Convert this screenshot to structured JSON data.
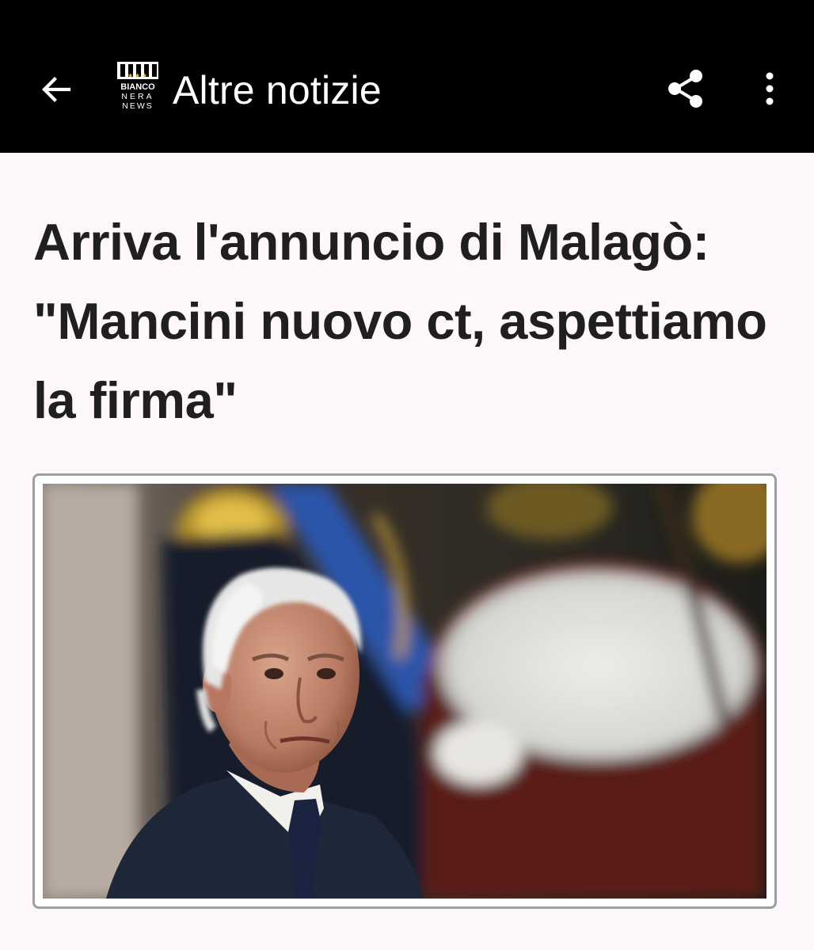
{
  "app_bar": {
    "title": "Altre notizie",
    "back_icon": "arrow-left-icon",
    "share_icon": "share-icon",
    "more_icon": "more-vert-icon",
    "logo": {
      "line1": "BIANCO",
      "line2": "NERA",
      "line3": "NEWS"
    }
  },
  "article": {
    "headline": "Arriva l'annuncio di Malagò: \"Mancini nuovo ct, aspettiamo la firma\""
  },
  "colors": {
    "app_bar_bg": "#000000",
    "page_bg": "#fdf7fc",
    "headline_text": "#1f1f1f",
    "photo_border": "#9ba1a3"
  }
}
